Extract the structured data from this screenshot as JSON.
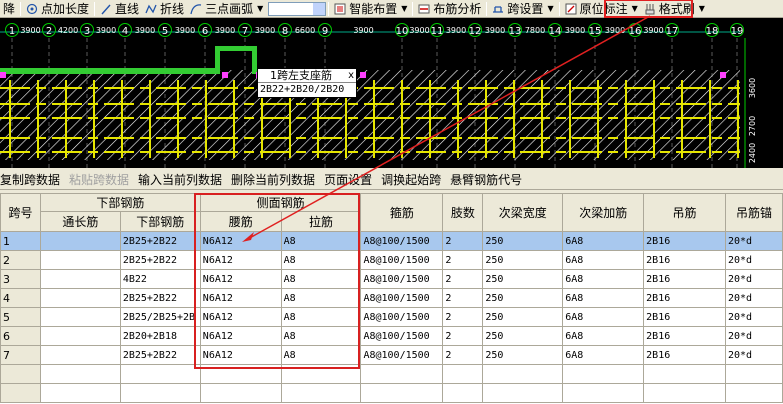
{
  "toolbar": {
    "items": [
      {
        "label": "降",
        "icon": "none"
      },
      {
        "label": "点加长度",
        "icon": "point-length-icon"
      },
      {
        "label": "直线",
        "icon": "line-icon"
      },
      {
        "label": "折线",
        "icon": "polyline-icon"
      },
      {
        "label": "三点画弧",
        "icon": "arc-icon"
      },
      {
        "label": "智能布置",
        "icon": "smart-layout-icon"
      },
      {
        "label": "布筋分析",
        "icon": "rebar-analysis-icon"
      },
      {
        "label": "跨设置",
        "icon": "span-settings-icon"
      },
      {
        "label": "原位标注",
        "icon": "in-situ-annotation-icon"
      },
      {
        "label": "格式刷",
        "icon": "format-brush-icon"
      }
    ]
  },
  "drawing": {
    "axis_labels": [
      "1",
      "2",
      "3",
      "4",
      "5",
      "6",
      "7",
      "8",
      "9",
      "10",
      "11",
      "12",
      "13",
      "14",
      "15",
      "16",
      "17",
      "18",
      "19"
    ],
    "dim_labels": [
      "3900",
      "4200",
      "3900",
      "3900",
      "3900",
      "3900",
      "3900",
      "6600",
      "3900",
      "3900",
      "3900",
      "3900",
      "7800",
      "3900",
      "3900",
      "3900"
    ],
    "side_dims": [
      "3600",
      "2700",
      "2400"
    ],
    "popup_title": "1跨左支座筋",
    "popup_value": "2B22+2B20/2B20",
    "popup_close": "x"
  },
  "toolbar2": {
    "items": [
      "复制跨数据",
      "粘贴跨数据",
      "输入当前列数据",
      "删除当前列数据",
      "页面设置",
      "调换起始跨",
      "悬臂钢筋代号"
    ],
    "disabled": [
      "粘贴跨数据"
    ]
  },
  "grid": {
    "group_headers": {
      "span": "跨号",
      "bottom": "下部钢筋",
      "side": "侧面钢筋",
      "stirrup": "箍筋",
      "legs": "肢数",
      "sub_width": "次梁宽度",
      "sub_add": "次梁加筋",
      "hanger": "吊筋",
      "hanger_anchor": "吊筋锚"
    },
    "sub_headers": {
      "through": "通长筋",
      "bottom_bar": "下部钢筋",
      "waist": "腰筋",
      "tie": "拉筋"
    },
    "rows": [
      {
        "n": "1",
        "through": "",
        "bottom": "2B25+2B22",
        "waist": "N6A12",
        "tie": "A8",
        "stirrup": "A8@100/1500",
        "legs": "2",
        "sub_width": "250",
        "sub_add": "6A8",
        "hanger": "2B16",
        "anchor": "20*d"
      },
      {
        "n": "2",
        "through": "",
        "bottom": "2B25+2B22",
        "waist": "N6A12",
        "tie": "A8",
        "stirrup": "A8@100/1500",
        "legs": "2",
        "sub_width": "250",
        "sub_add": "6A8",
        "hanger": "2B16",
        "anchor": "20*d"
      },
      {
        "n": "3",
        "through": "",
        "bottom": "4B22",
        "waist": "N6A12",
        "tie": "A8",
        "stirrup": "A8@100/1500",
        "legs": "2",
        "sub_width": "250",
        "sub_add": "6A8",
        "hanger": "2B16",
        "anchor": "20*d"
      },
      {
        "n": "4",
        "through": "",
        "bottom": "2B25+2B22",
        "waist": "N6A12",
        "tie": "A8",
        "stirrup": "A8@100/1500",
        "legs": "2",
        "sub_width": "250",
        "sub_add": "6A8",
        "hanger": "2B16",
        "anchor": "20*d"
      },
      {
        "n": "5",
        "through": "",
        "bottom": "2B25/2B25+2B",
        "waist": "N6A12",
        "tie": "A8",
        "stirrup": "A8@100/1500",
        "legs": "2",
        "sub_width": "250",
        "sub_add": "6A8",
        "hanger": "2B16",
        "anchor": "20*d"
      },
      {
        "n": "6",
        "through": "",
        "bottom": "2B20+2B18",
        "waist": "N6A12",
        "tie": "A8",
        "stirrup": "A8@100/1500",
        "legs": "2",
        "sub_width": "250",
        "sub_add": "6A8",
        "hanger": "2B16",
        "anchor": "20*d"
      },
      {
        "n": "7",
        "through": "",
        "bottom": "2B25+2B22",
        "waist": "N6A12",
        "tie": "A8",
        "stirrup": "A8@100/1500",
        "legs": "2",
        "sub_width": "250",
        "sub_add": "6A8",
        "hanger": "2B16",
        "anchor": "20*d"
      }
    ],
    "selected_row": 0
  },
  "colors": {
    "highlight": "#e02020",
    "selection": "#a8c8ee",
    "beam": "#e6e600",
    "axis": "#00cc00",
    "canvas": "#000000"
  }
}
